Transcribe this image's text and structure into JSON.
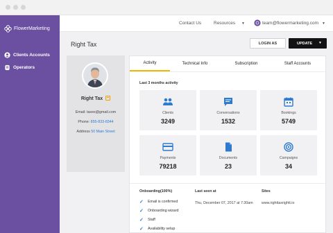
{
  "sidebar": {
    "brand": "FlowerMarketing",
    "items": [
      {
        "label": "Clients Accounts",
        "icon": "users-icon"
      },
      {
        "label": "Operators",
        "icon": "operator-icon"
      }
    ]
  },
  "topbar": {
    "contact": "Contact Us",
    "resources": "Resources",
    "user_email": "team@flowermarketing.com"
  },
  "page": {
    "title": "Right Tax",
    "login_as": "LOGIN AS",
    "update": "UPDATE"
  },
  "profile": {
    "name": "Right Tax",
    "email_label": "Email:",
    "email": "taxes@gmail.com",
    "phone_label": "Phone:",
    "phone": "855-833-8344",
    "address_label": "Address",
    "address": "50 Main Street"
  },
  "tabs": [
    {
      "label": "Activity",
      "active": true
    },
    {
      "label": "Technical Info",
      "active": false
    },
    {
      "label": "Subscription",
      "active": false
    },
    {
      "label": "Staff Accounts",
      "active": false
    }
  ],
  "activity": {
    "title": "Last 3 months activity",
    "cards": [
      {
        "label": "Clients",
        "value": "3249",
        "icon": "users-icon"
      },
      {
        "label": "Conversations",
        "value": "1532",
        "icon": "chat-icon"
      },
      {
        "label": "Bookings",
        "value": "5749",
        "icon": "calendar-icon"
      },
      {
        "label": "Payments",
        "value": "79218",
        "icon": "credit-card-icon"
      },
      {
        "label": "Documents",
        "value": "23",
        "icon": "document-icon"
      },
      {
        "label": "Campaigns",
        "value": "34",
        "icon": "target-icon"
      }
    ]
  },
  "onboarding": {
    "title": "Onboarding(100%)",
    "items": [
      "Email is confirmed",
      "Onboarding wizard",
      "Staff",
      "Availability setup"
    ]
  },
  "last_seen": {
    "title": "Last seen at",
    "value": "Thu, December 07, 2017 at 7:30am"
  },
  "sites": {
    "title": "Sites",
    "value": "www.righttaxrightt.io"
  },
  "colors": {
    "sidebar": "#6b4fa0",
    "accent": "#2d7bd1",
    "tab_underline": "#f0b800"
  }
}
